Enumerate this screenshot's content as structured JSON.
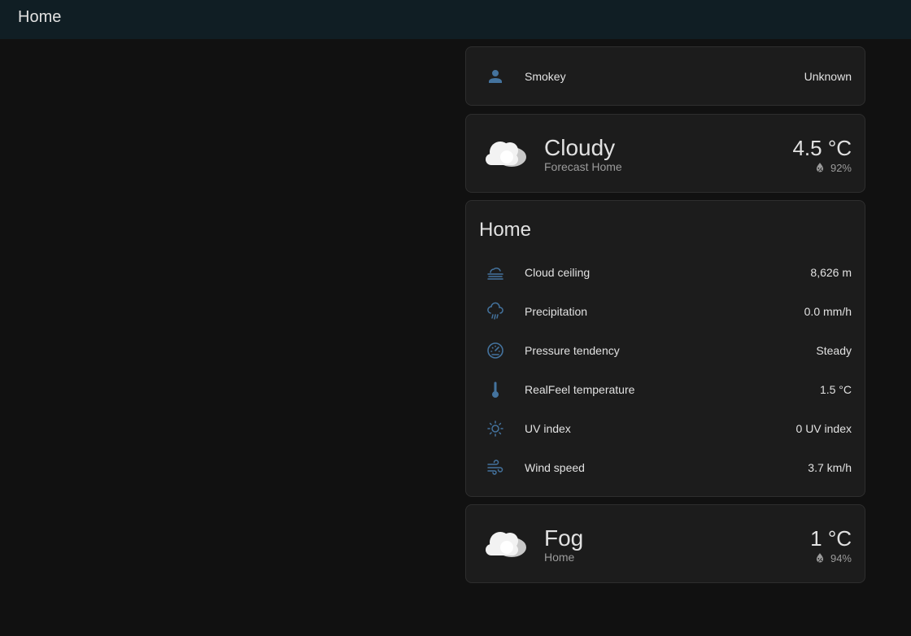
{
  "header": {
    "title": "Home"
  },
  "person_card": {
    "icon": "account-icon",
    "name": "Smokey",
    "state": "Unknown"
  },
  "weather_forecast": {
    "icon": "cloudy-icon",
    "state": "Cloudy",
    "name": "Forecast Home",
    "temperature": "4.5 °C",
    "humidity": "92%"
  },
  "entities_card": {
    "title": "Home",
    "rows": [
      {
        "icon": "weather-fog-icon",
        "label": "Cloud ceiling",
        "value": "8,626 m"
      },
      {
        "icon": "weather-rainy-icon",
        "label": "Precipitation",
        "value": "0.0 mm/h"
      },
      {
        "icon": "gauge-icon",
        "label": "Pressure tendency",
        "value": "Steady"
      },
      {
        "icon": "thermometer-icon",
        "label": "RealFeel temperature",
        "value": "1.5 °C"
      },
      {
        "icon": "sun-icon",
        "label": "UV index",
        "value": "0 UV index"
      },
      {
        "icon": "wind-icon",
        "label": "Wind speed",
        "value": "3.7 km/h"
      }
    ]
  },
  "weather_home": {
    "icon": "cloudy-icon",
    "state": "Fog",
    "name": "Home",
    "temperature": "1 °C",
    "humidity": "94%"
  },
  "colors": {
    "background": "#111111",
    "header": "#101e24",
    "card": "#1c1c1c",
    "icon": "#44739e",
    "text": "#e1e1e1",
    "secondary_text": "#9b9b9b"
  }
}
